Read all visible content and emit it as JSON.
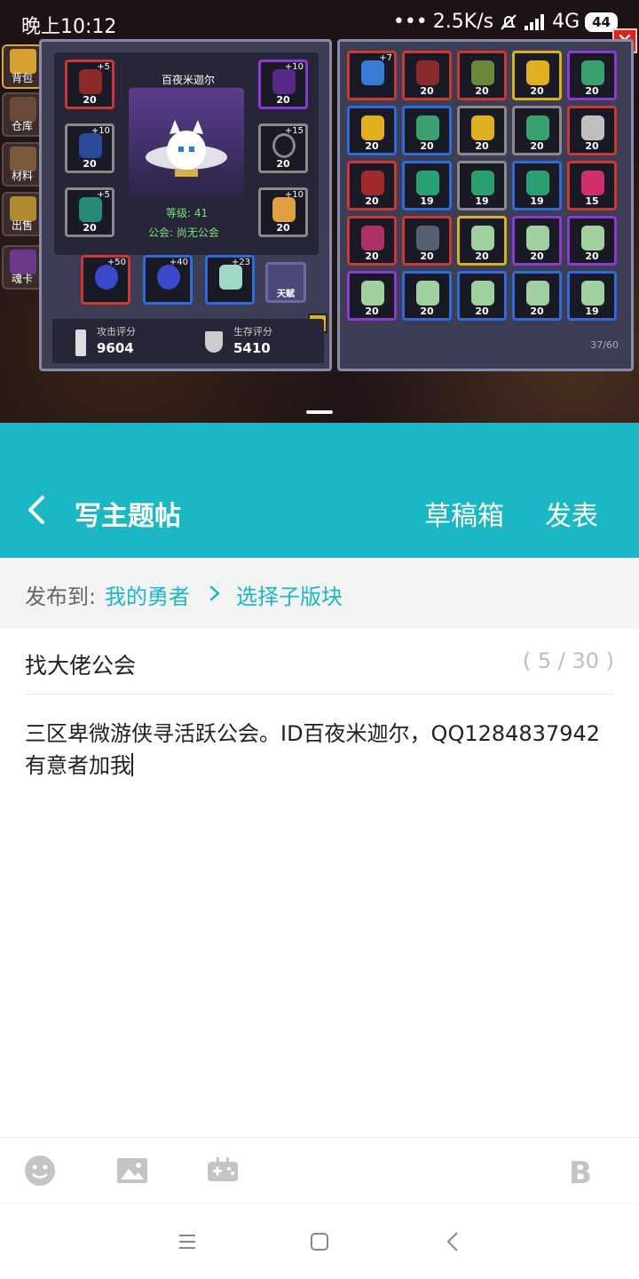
{
  "status_bar": {
    "time": "晚上10:12",
    "network_speed": "2.5K/s",
    "network_type": "4G",
    "battery": "44"
  },
  "game": {
    "side_tabs": [
      "背包",
      "仓库",
      "材料",
      "出售",
      "魂卡"
    ],
    "character": {
      "name": "百夜米迦尔",
      "level": "等级: 41",
      "guild": "公会: 尚无公会"
    },
    "equipment": [
      {
        "plus": "+5",
        "level": "20",
        "rarity": "red"
      },
      {
        "plus": "+10",
        "level": "20",
        "rarity": "purple"
      },
      {
        "plus": "+10",
        "level": "20",
        "rarity": "gray"
      },
      {
        "plus": "+15",
        "level": "20",
        "rarity": "gray"
      },
      {
        "plus": "+5",
        "level": "20",
        "rarity": "gray"
      },
      {
        "plus": "+10",
        "level": "20",
        "rarity": "gray"
      }
    ],
    "weapons": [
      {
        "plus": "+50",
        "rarity": "red"
      },
      {
        "plus": "+40",
        "rarity": "blue"
      },
      {
        "plus": "+23",
        "rarity": "blue"
      }
    ],
    "talent_label": "天赋",
    "attack_score_label": "攻击评分",
    "attack_score": "9604",
    "survival_score_label": "生存评分",
    "survival_score": "5410",
    "inventory": [
      {
        "plus": "+7",
        "level": "",
        "rarity": "red",
        "color": "#3a7bd5"
      },
      {
        "plus": "",
        "level": "20",
        "rarity": "red",
        "color": "#8a2a2a"
      },
      {
        "plus": "",
        "level": "20",
        "rarity": "red",
        "color": "#6a8a3a"
      },
      {
        "plus": "",
        "level": "20",
        "rarity": "gold",
        "color": "#e0b020"
      },
      {
        "plus": "",
        "level": "20",
        "rarity": "purple",
        "color": "#3aa070"
      },
      {
        "plus": "",
        "level": "20",
        "rarity": "blue",
        "color": "#e0b020"
      },
      {
        "plus": "",
        "level": "20",
        "rarity": "blue",
        "color": "#3aa070"
      },
      {
        "plus": "",
        "level": "20",
        "rarity": "gray",
        "color": "#e0b020"
      },
      {
        "plus": "",
        "level": "20",
        "rarity": "gray",
        "color": "#3aa070"
      },
      {
        "plus": "",
        "level": "20",
        "rarity": "red",
        "color": "#c0c0c0"
      },
      {
        "plus": "",
        "level": "20",
        "rarity": "red",
        "color": "#a02a2a"
      },
      {
        "plus": "",
        "level": "19",
        "rarity": "blue",
        "color": "#2aa070"
      },
      {
        "plus": "",
        "level": "19",
        "rarity": "gray",
        "color": "#2aa070"
      },
      {
        "plus": "",
        "level": "19",
        "rarity": "blue",
        "color": "#2aa070"
      },
      {
        "plus": "",
        "level": "15",
        "rarity": "red",
        "color": "#d0306a"
      },
      {
        "plus": "",
        "level": "20",
        "rarity": "red",
        "color": "#b0306a"
      },
      {
        "plus": "",
        "level": "20",
        "rarity": "red",
        "color": "#556070"
      },
      {
        "plus": "",
        "level": "20",
        "rarity": "gold",
        "color": "#a0d0a0"
      },
      {
        "plus": "",
        "level": "20",
        "rarity": "purple",
        "color": "#a0d0a0"
      },
      {
        "plus": "",
        "level": "20",
        "rarity": "purple",
        "color": "#a0d0a0"
      },
      {
        "plus": "",
        "level": "20",
        "rarity": "purple",
        "color": "#a0d0a0"
      },
      {
        "plus": "",
        "level": "20",
        "rarity": "blue",
        "color": "#a0d0a0"
      },
      {
        "plus": "",
        "level": "20",
        "rarity": "blue",
        "color": "#a0d0a0"
      },
      {
        "plus": "",
        "level": "20",
        "rarity": "blue",
        "color": "#a0d0a0"
      },
      {
        "plus": "",
        "level": "19",
        "rarity": "blue",
        "color": "#a0d0a0"
      }
    ],
    "inventory_count": "37/60"
  },
  "header": {
    "title": "写主题帖",
    "drafts_label": "草稿箱",
    "publish_label": "发表"
  },
  "publish_to": {
    "label": "发布到:",
    "forum": "我的勇者",
    "subforum": "选择子版块"
  },
  "post": {
    "title": "找大佬公会",
    "title_count": "( 5 / 30 )",
    "body": "三区卑微游侠寻活跃公会。ID百夜米迦尔，QQ1284837942有意者加我"
  },
  "colors": {
    "accent": "#1bb7c4",
    "link": "#1bb7c4"
  }
}
